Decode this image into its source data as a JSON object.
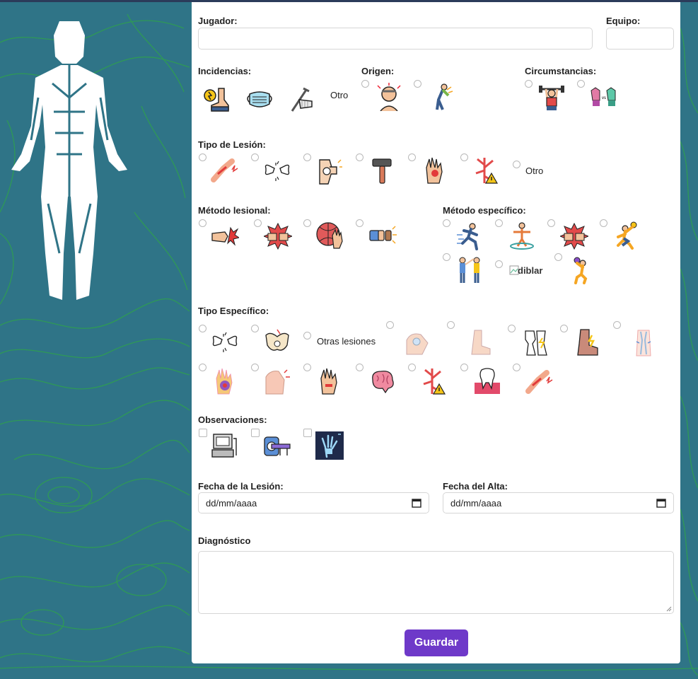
{
  "colors": {
    "background": "#2f7487",
    "contour_lines": "#2fa04e",
    "panel": "#ffffff",
    "accent_button": "#6e39c9",
    "figure": "#ffffff"
  },
  "form": {
    "jugador_label": "Jugador:",
    "jugador_value": "",
    "equipo_label": "Equipo:",
    "equipo_value": "",
    "incidencias_label": "Incidencias:",
    "incidencias_otro": "Otro",
    "origen_label": "Origen:",
    "circunstancias_label": "Circumstancias:",
    "tipo_lesion_label": "Tipo de Lesión:",
    "tipo_lesion_otro": "Otro",
    "metodo_lesional_label": "Método lesional:",
    "metodo_especifico_label": "Método específico:",
    "broken_image_alt": "diblar",
    "tipo_especifico_label": "Tipo Específico:",
    "otras_lesiones": "Otras lesiones",
    "observaciones_label": "Observaciones:",
    "fecha_lesion_label": "Fecha de la Lesión:",
    "fecha_lesion_placeholder": "dd/mm/aaaa",
    "fecha_alta_label": "Fecha del Alta:",
    "fecha_alta_placeholder": "dd/mm/aaaa",
    "diagnostico_label": "Diagnóstico",
    "diagnostico_value": "",
    "save_label": "Guardar"
  },
  "icons": {
    "incidencias": [
      "injured-foot-icon",
      "face-mask-icon",
      "crutches-cast-icon"
    ],
    "origen": [
      "headache-person-icon",
      "back-pain-person-icon"
    ],
    "circunstancias": [
      "weightlifter-icon",
      "team-jerseys-icon"
    ],
    "tipo_lesion": [
      "arm-pain-icon",
      "bone-fracture-icon",
      "knee-joint-icon",
      "hammer-icon",
      "hand-injury-icon",
      "blood-vessel-warning-icon"
    ],
    "metodo_lesional": [
      "punch-impact-icon",
      "clash-impact-icon",
      "ball-hand-icon",
      "fist-bump-icon"
    ],
    "metodo_especifico": [
      "sprinting-player-icon",
      "jumping-athlete-icon",
      "clash-impact-icon",
      "handball-thrower-icon",
      "two-players-icon",
      "broken-image-icon",
      "handball-jump-shot-icon"
    ],
    "tipo_especifico": [
      "bone-fracture-icon",
      "pelvis-injury-icon",
      "shoulder-joint-icon",
      "foot-icon",
      "knee-joint-icon",
      "ankle-pain-icon",
      "knee-xray-icon",
      "hand-bruise-icon",
      "shoulder-pain-icon",
      "hand-wound-icon",
      "brain-icon",
      "blood-vessel-warning-icon",
      "tooth-gum-icon",
      "arm-pain-icon"
    ],
    "observaciones": [
      "ultrasound-machine-icon",
      "mri-scanner-icon",
      "xray-hand-icon"
    ]
  }
}
